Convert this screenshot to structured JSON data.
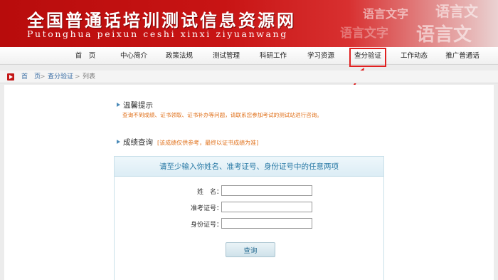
{
  "banner": {
    "title": "全国普通话培训测试信息资源网",
    "subtitle": "Putonghua peixun ceshi xinxi ziyuanwang",
    "deco_1": "语言文字",
    "deco_2": "语言文",
    "deco_3": "语言文字",
    "deco_4": "语言文"
  },
  "nav": {
    "items": [
      {
        "label": "首　页"
      },
      {
        "label": "中心简介"
      },
      {
        "label": "政策法规"
      },
      {
        "label": "测试管理"
      },
      {
        "label": "科研工作"
      },
      {
        "label": "学习资源"
      },
      {
        "label": "查分验证"
      },
      {
        "label": "工作动态"
      },
      {
        "label": "推广普通话"
      }
    ],
    "highlighted": "查分验证",
    "highlight_color": "#e02020"
  },
  "breadcrumb": {
    "home": "首　页",
    "sep": ">",
    "section": "查分验证",
    "current": "列表"
  },
  "notice": {
    "title": "温馨提示",
    "text": "查询不到成绩、证书领取、证书补办等问题，请联系您参加考试的测试站进行咨询。"
  },
  "query": {
    "title": "成绩查询",
    "note": "[该成绩仅供参考，最终以证书成绩为准]"
  },
  "form": {
    "header": "请至少输入你姓名、准考证号、身份证号中的任意两项",
    "fields": [
      {
        "label": "姓　名：",
        "value": ""
      },
      {
        "label": "准考证号：",
        "value": ""
      },
      {
        "label": "身份证号：",
        "value": ""
      }
    ],
    "submit_label": "查询"
  },
  "colors": {
    "brand_red": "#c41818",
    "accent_orange": "#e0701a",
    "accent_blue": "#2a7aa6"
  }
}
